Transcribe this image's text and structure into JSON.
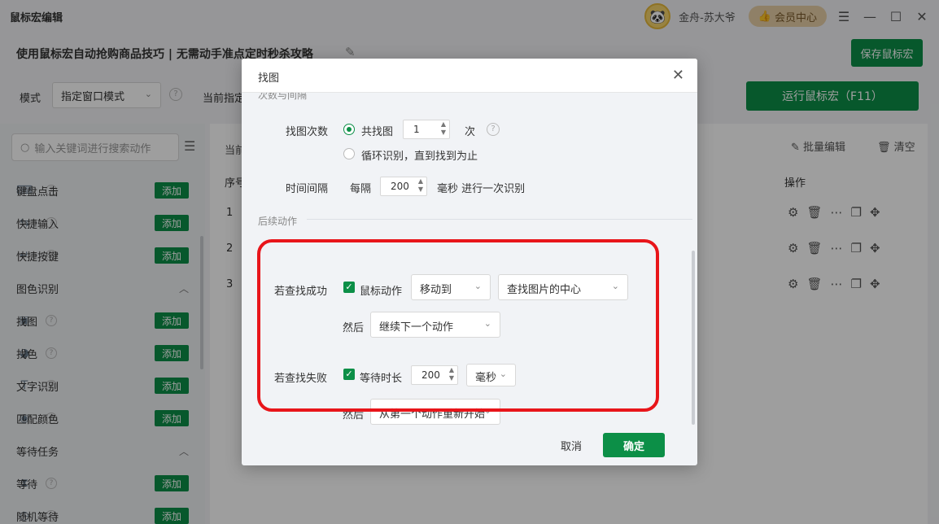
{
  "app": {
    "title": "鼠标宏编辑",
    "username": "金舟-苏大爷",
    "vip_label": "会员中心"
  },
  "header": {
    "macro_name": "使用鼠标宏自动抢购商品技巧 | 无需动手准点定时秒杀攻略",
    "save_label": "保存鼠标宏"
  },
  "mode_row": {
    "mode_label": "模式",
    "mode_value": "指定窗口模式",
    "current_label": "当前指定",
    "run_label": "运行鼠标宏（F11）"
  },
  "sidebar": {
    "search_placeholder": "输入关键词进行搜索动作",
    "add_label": "添加",
    "items": [
      {
        "label": "键盘点击",
        "icon": "keyboard-icon"
      },
      {
        "label": "快捷输入",
        "icon": "quick-input-icon"
      },
      {
        "label": "快捷按键",
        "icon": "hotkey-icon"
      },
      {
        "label": "找图",
        "icon": "image-icon"
      },
      {
        "label": "找色",
        "icon": "palette-icon"
      },
      {
        "label": "文字识别",
        "icon": "text-ocr-icon"
      },
      {
        "label": "匹配颜色",
        "icon": "color-match-icon"
      },
      {
        "label": "等待",
        "icon": "hourglass-icon"
      },
      {
        "label": "随机等待",
        "icon": "random-wait-icon"
      }
    ],
    "groups": [
      "图色识别",
      "等待任务"
    ]
  },
  "main": {
    "current_prefix": "当前",
    "batch_edit": "批量编辑",
    "clear": "清空",
    "col_seq": "序号",
    "col_ops": "操作",
    "rows": [
      "1",
      "2",
      "3"
    ]
  },
  "dialog": {
    "title": "找图",
    "section_prev": "次数与间隔",
    "find_count_label": "找图次数",
    "find_total_label": "共找图",
    "find_total_value": "1",
    "times_unit": "次",
    "loop_label": "循环识别，直到找到为止",
    "interval_label": "时间间隔",
    "interval_every": "每隔",
    "interval_value": "200",
    "interval_suffix": "毫秒 进行一次识别",
    "section_followup": "后续动作",
    "success_label": "若查找成功",
    "success_check_label": "鼠标动作",
    "success_action": "移动到",
    "success_target": "查找图片的中心",
    "then_label": "然后",
    "success_then": "继续下一个动作",
    "fail_label": "若查找失败",
    "fail_check_label": "等待时长",
    "fail_wait_value": "200",
    "fail_unit": "毫秒",
    "fail_then": "从第一个动作重新开始",
    "cancel_label": "取消",
    "ok_label": "确定"
  },
  "colors": {
    "accent": "#0c8f47",
    "highlight_frame": "#e8151a"
  }
}
